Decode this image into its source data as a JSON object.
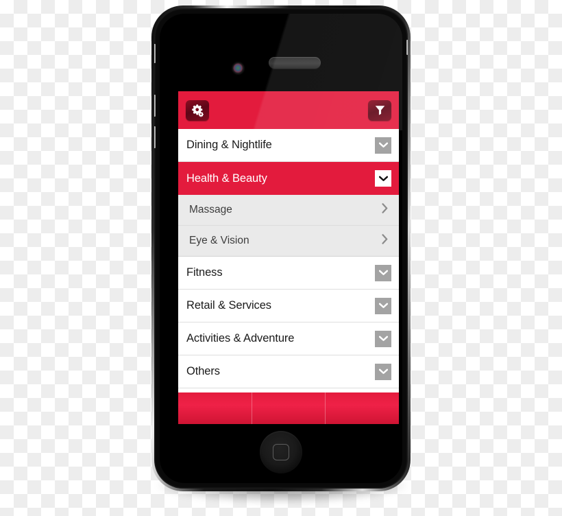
{
  "device": {
    "type": "smartphone-mockup",
    "hardware": {
      "earpiece": "earpiece-speaker",
      "front_camera": "front-camera",
      "home_button": "home-button",
      "silent_switch": "silent-switch",
      "volume_up": "volume-up-button",
      "volume_down": "volume-down-button",
      "side_port": "side-port"
    }
  },
  "app": {
    "header": {
      "settings_icon": "gear-icon",
      "filter_icon": "filter-icon"
    },
    "categories": [
      {
        "label": "Dining & Nightlife",
        "state": "collapsed",
        "chevron": "chevron-down-icon",
        "children": []
      },
      {
        "label": "Health & Beauty",
        "state": "expanded",
        "chevron": "chevron-down-icon",
        "children": [
          {
            "label": "Massage",
            "chevron": "chevron-right-icon"
          },
          {
            "label": "Eye & Vision",
            "chevron": "chevron-right-icon"
          }
        ]
      },
      {
        "label": "Fitness",
        "state": "collapsed",
        "chevron": "chevron-down-icon",
        "children": []
      },
      {
        "label": "Retail & Services",
        "state": "collapsed",
        "chevron": "chevron-down-icon",
        "children": []
      },
      {
        "label": "Activities & Adventure",
        "state": "collapsed",
        "chevron": "chevron-down-icon",
        "children": []
      },
      {
        "label": "Others",
        "state": "collapsed",
        "chevron": "chevron-down-icon",
        "children": []
      }
    ],
    "toolbar": {
      "segments": [
        "",
        "",
        ""
      ]
    }
  },
  "colors": {
    "brand_red": "#E31B3D",
    "brand_red_dark": "#8D0D22",
    "toolbar_red_light": "#EF2147",
    "toolbar_red_dark": "#CF1433",
    "row_white": "#FFFFFF",
    "submenu_gray": "#EAEAEA",
    "chevron_box_gray": "#A3A3A3",
    "text_dark": "#1A1A1A",
    "text_sub": "#3D3D3D",
    "separator": "#DEDEDE"
  }
}
